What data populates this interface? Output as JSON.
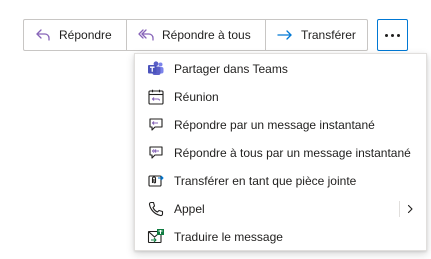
{
  "toolbar": {
    "reply_label": "Répondre",
    "reply_all_label": "Répondre à tous",
    "forward_label": "Transférer"
  },
  "menu": {
    "items": [
      {
        "label": "Partager dans Teams",
        "icon": "teams-icon"
      },
      {
        "label": "Réunion",
        "icon": "calendar-meeting-icon"
      },
      {
        "label": "Répondre par un message instantané",
        "icon": "chat-reply-icon"
      },
      {
        "label": "Répondre à tous par un message instantané",
        "icon": "chat-reply-all-icon"
      },
      {
        "label": "Transférer en tant que pièce jointe",
        "icon": "attachment-forward-icon"
      },
      {
        "label": "Appel",
        "icon": "phone-icon",
        "has_submenu": true
      },
      {
        "label": "Traduire le message",
        "icon": "translate-icon"
      }
    ]
  },
  "colors": {
    "accent": "#0078d4",
    "reply_icon": "#8764b8",
    "teams": "#5b5fc7",
    "translate": "#107c41",
    "border": "#c8c6c4"
  }
}
